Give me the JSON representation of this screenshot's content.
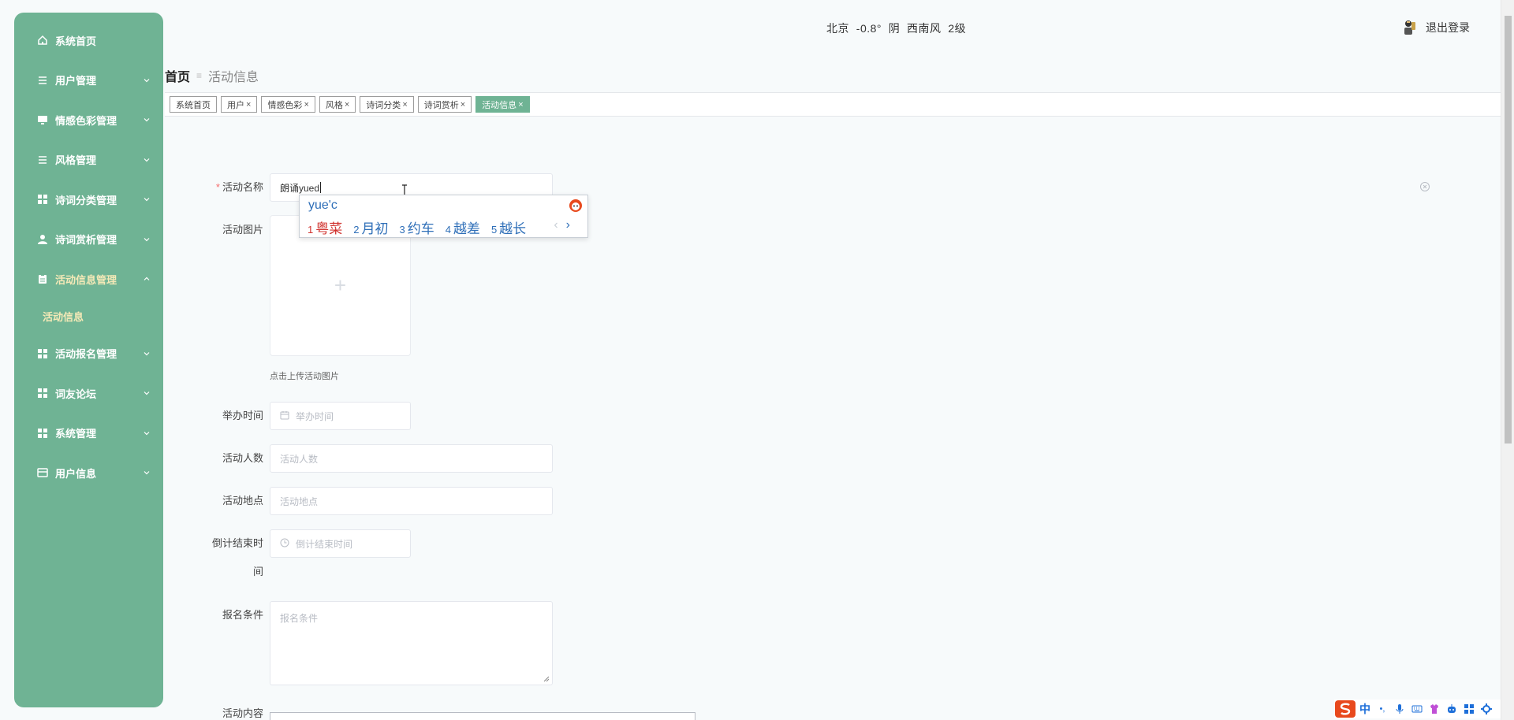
{
  "sidebar": {
    "items": [
      {
        "label": "系统首页",
        "icon": "home-icon",
        "has_arrow": false
      },
      {
        "label": "用户管理",
        "icon": "list-icon",
        "has_arrow": true
      },
      {
        "label": "情感色彩管理",
        "icon": "monitor-icon",
        "has_arrow": true
      },
      {
        "label": "风格管理",
        "icon": "list-icon",
        "has_arrow": true
      },
      {
        "label": "诗词分类管理",
        "icon": "grid-icon",
        "has_arrow": true
      },
      {
        "label": "诗词赏析管理",
        "icon": "user-icon",
        "has_arrow": true
      },
      {
        "label": "活动信息管理",
        "icon": "clipboard-icon",
        "has_arrow": true,
        "open": true
      },
      {
        "label": "活动报名管理",
        "icon": "grid-icon",
        "has_arrow": true
      },
      {
        "label": "词友论坛",
        "icon": "grid-icon",
        "has_arrow": true
      },
      {
        "label": "系统管理",
        "icon": "grid-icon",
        "has_arrow": true
      },
      {
        "label": "用户信息",
        "icon": "card-icon",
        "has_arrow": true
      }
    ],
    "submenu": [
      "活动信息"
    ]
  },
  "header": {
    "weather": "北京  -0.8°  阴  西南风  2级",
    "logout": "退出登录"
  },
  "breadcrumb": {
    "home": "首页",
    "current": "活动信息"
  },
  "tags": [
    {
      "label": "系统首页",
      "closable": false,
      "active": false
    },
    {
      "label": "用户",
      "closable": true,
      "active": false
    },
    {
      "label": "情感色彩",
      "closable": true,
      "active": false
    },
    {
      "label": "风格",
      "closable": true,
      "active": false
    },
    {
      "label": "诗词分类",
      "closable": true,
      "active": false
    },
    {
      "label": "诗词赏析",
      "closable": true,
      "active": false
    },
    {
      "label": "活动信息",
      "closable": true,
      "active": true
    }
  ],
  "tag_close_glyph": "×",
  "form": {
    "name_label": "活动名称",
    "name_value": "朗诵yued",
    "required_mark": "*",
    "image_label": "活动图片",
    "image_plus": "+",
    "upload_tip": "点击上传活动图片",
    "time_label": "举办时间",
    "time_placeholder": "举办时间",
    "count_label": "活动人数",
    "count_placeholder": "活动人数",
    "place_label": "活动地点",
    "place_placeholder": "活动地点",
    "countdown_label_1": "倒计结束时",
    "countdown_label_2": "间",
    "countdown_placeholder": "倒计结束时间",
    "condition_label": "报名条件",
    "condition_placeholder": "报名条件",
    "content_label": "活动内容"
  },
  "ime": {
    "composition": "yue'c",
    "candidates": [
      {
        "num": "1",
        "text": "粤菜"
      },
      {
        "num": "2",
        "text": "月初"
      },
      {
        "num": "3",
        "text": "约车"
      },
      {
        "num": "4",
        "text": "越差"
      },
      {
        "num": "5",
        "text": "越长"
      }
    ],
    "prev": "‹",
    "next": "›"
  },
  "ime_toolbar": {
    "lang": "中",
    "punct": "•,"
  },
  "colors": {
    "sidebar_bg": "#6fb394",
    "active_tag": "#6fb394",
    "submenu_text": "#f5e9b7",
    "ime_blue": "#2f6fb8",
    "ime_first": "#d0312d"
  }
}
